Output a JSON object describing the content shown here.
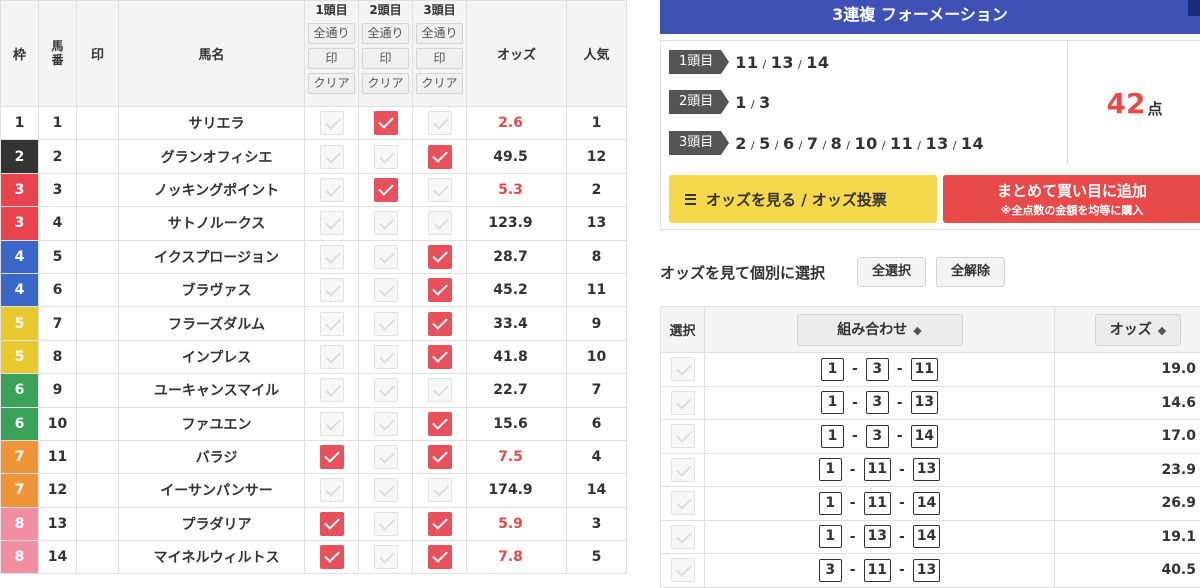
{
  "horse_table": {
    "headers": {
      "waku": "枠",
      "umaban": "馬番",
      "mark": "印",
      "name": "馬名",
      "odds": "オッズ",
      "popularity": "人気"
    },
    "positions": [
      {
        "title": "1頭目",
        "all_label": "全通り",
        "mark_label": "印",
        "clear_label": "クリア"
      },
      {
        "title": "2頭目",
        "all_label": "全通り",
        "mark_label": "印",
        "clear_label": "クリア"
      },
      {
        "title": "3頭目",
        "all_label": "全通り",
        "mark_label": "印",
        "clear_label": "クリア"
      }
    ],
    "rows": [
      {
        "waku": "1",
        "num": "1",
        "name": "サリエラ",
        "odds": "2.6",
        "pop": "1",
        "hot": true,
        "p1": false,
        "p2": true,
        "p3": false,
        "color": "#ffffff",
        "text": "#333333"
      },
      {
        "waku": "2",
        "num": "2",
        "name": "グランオフィシエ",
        "odds": "49.5",
        "pop": "12",
        "hot": false,
        "p1": false,
        "p2": false,
        "p3": true,
        "color": "#333333",
        "text": "#ffffff"
      },
      {
        "waku": "3",
        "num": "3",
        "name": "ノッキングポイント",
        "odds": "5.3",
        "pop": "2",
        "hot": true,
        "p1": false,
        "p2": true,
        "p3": false,
        "color": "#e8444e",
        "text": "#ffffff"
      },
      {
        "waku": "3",
        "num": "4",
        "name": "サトノルークス",
        "odds": "123.9",
        "pop": "13",
        "hot": false,
        "p1": false,
        "p2": false,
        "p3": false,
        "color": "#e8444e",
        "text": "#ffffff"
      },
      {
        "waku": "4",
        "num": "5",
        "name": "イクスプロージョン",
        "odds": "28.7",
        "pop": "8",
        "hot": false,
        "p1": false,
        "p2": false,
        "p3": true,
        "color": "#3b67c8",
        "text": "#ffffff"
      },
      {
        "waku": "4",
        "num": "6",
        "name": "ブラヴァス",
        "odds": "45.2",
        "pop": "11",
        "hot": false,
        "p1": false,
        "p2": false,
        "p3": true,
        "color": "#3b67c8",
        "text": "#ffffff"
      },
      {
        "waku": "5",
        "num": "7",
        "name": "フラーズダルム",
        "odds": "33.4",
        "pop": "9",
        "hot": false,
        "p1": false,
        "p2": false,
        "p3": true,
        "color": "#e8c92e",
        "text": "#ffffff"
      },
      {
        "waku": "5",
        "num": "8",
        "name": "インプレス",
        "odds": "41.8",
        "pop": "10",
        "hot": false,
        "p1": false,
        "p2": false,
        "p3": true,
        "color": "#e8c92e",
        "text": "#ffffff"
      },
      {
        "waku": "6",
        "num": "9",
        "name": "ユーキャンスマイル",
        "odds": "22.7",
        "pop": "7",
        "hot": false,
        "p1": false,
        "p2": false,
        "p3": false,
        "color": "#3aa359",
        "text": "#ffffff"
      },
      {
        "waku": "6",
        "num": "10",
        "name": "ファユエン",
        "odds": "15.6",
        "pop": "6",
        "hot": false,
        "p1": false,
        "p2": false,
        "p3": true,
        "color": "#3aa359",
        "text": "#ffffff"
      },
      {
        "waku": "7",
        "num": "11",
        "name": "バラジ",
        "odds": "7.5",
        "pop": "4",
        "hot": true,
        "p1": true,
        "p2": false,
        "p3": true,
        "color": "#f0943a",
        "text": "#ffffff"
      },
      {
        "waku": "7",
        "num": "12",
        "name": "イーサンパンサー",
        "odds": "174.9",
        "pop": "14",
        "hot": false,
        "p1": false,
        "p2": false,
        "p3": false,
        "color": "#f0943a",
        "text": "#ffffff"
      },
      {
        "waku": "8",
        "num": "13",
        "name": "プラダリア",
        "odds": "5.9",
        "pop": "3",
        "hot": true,
        "p1": true,
        "p2": false,
        "p3": true,
        "color": "#f18ea3",
        "text": "#ffffff"
      },
      {
        "waku": "8",
        "num": "14",
        "name": "マイネルウィルトス",
        "odds": "7.8",
        "pop": "5",
        "hot": true,
        "p1": true,
        "p2": false,
        "p3": true,
        "color": "#f18ea3",
        "text": "#ffffff"
      }
    ]
  },
  "formation": {
    "title": "3連複 フォーメーション",
    "rows": [
      {
        "label": "1頭目",
        "nums": [
          "11",
          "13",
          "14"
        ]
      },
      {
        "label": "2頭目",
        "nums": [
          "1",
          "3"
        ]
      },
      {
        "label": "3頭目",
        "nums": [
          "2",
          "5",
          "6",
          "7",
          "8",
          "10",
          "11",
          "13",
          "14"
        ]
      }
    ],
    "points_value": "42",
    "points_unit": "点",
    "odds_button_label": "オッズを見る / オッズ投票",
    "add_button_label": "まとめて買い目に追加",
    "add_button_sub": "※全点数の金額を均等に購入"
  },
  "individual": {
    "title": "オッズを見て個別に選択",
    "select_all_label": "全選択",
    "deselect_all_label": "全解除",
    "headers": {
      "select": "選択",
      "combo": "組み合わせ",
      "odds": "オッズ",
      "sort_arrow": "◆"
    },
    "rows": [
      {
        "combo": [
          "1",
          "3",
          "11"
        ],
        "odds": "19.0"
      },
      {
        "combo": [
          "1",
          "3",
          "13"
        ],
        "odds": "14.6"
      },
      {
        "combo": [
          "1",
          "3",
          "14"
        ],
        "odds": "17.0"
      },
      {
        "combo": [
          "1",
          "11",
          "13"
        ],
        "odds": "23.9"
      },
      {
        "combo": [
          "1",
          "11",
          "14"
        ],
        "odds": "26.9"
      },
      {
        "combo": [
          "1",
          "13",
          "14"
        ],
        "odds": "19.1"
      },
      {
        "combo": [
          "3",
          "11",
          "13"
        ],
        "odds": "40.5"
      }
    ]
  },
  "colors": {
    "accent_red": "#e84a4a",
    "header_blue": "#3f51b5",
    "button_yellow": "#f5d94a"
  }
}
